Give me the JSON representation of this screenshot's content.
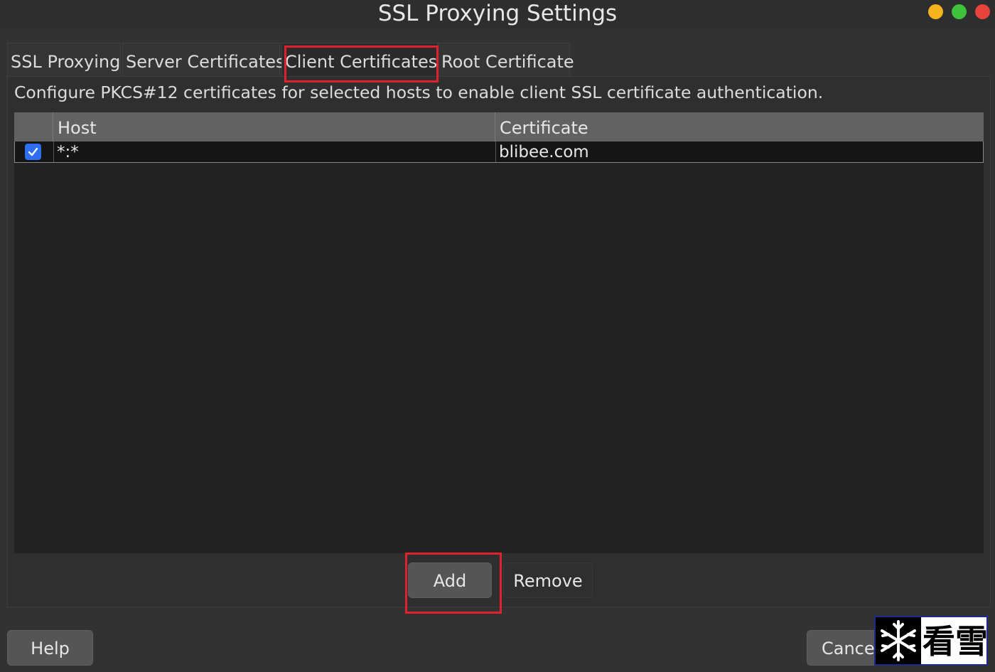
{
  "window": {
    "title": "SSL Proxying Settings"
  },
  "tabs": [
    {
      "label": "SSL Proxying"
    },
    {
      "label": "Server Certificates"
    },
    {
      "label": "Client Certificates",
      "selected": true
    },
    {
      "label": "Root Certificate"
    }
  ],
  "panel": {
    "description": "Configure PKCS#12 certificates for selected hosts to enable client SSL certificate authentication."
  },
  "table": {
    "columns": [
      "",
      "Host",
      "Certificate"
    ],
    "rows": [
      {
        "enabled": true,
        "host": "*:*",
        "certificate": "blibee.com"
      }
    ]
  },
  "buttons": {
    "add": "Add",
    "remove": "Remove",
    "help": "Help",
    "cancel": "Cance"
  },
  "watermark": {
    "text": "看雪"
  },
  "colors": {
    "accent": "#2d6ff0",
    "highlight": "#e0222e"
  }
}
